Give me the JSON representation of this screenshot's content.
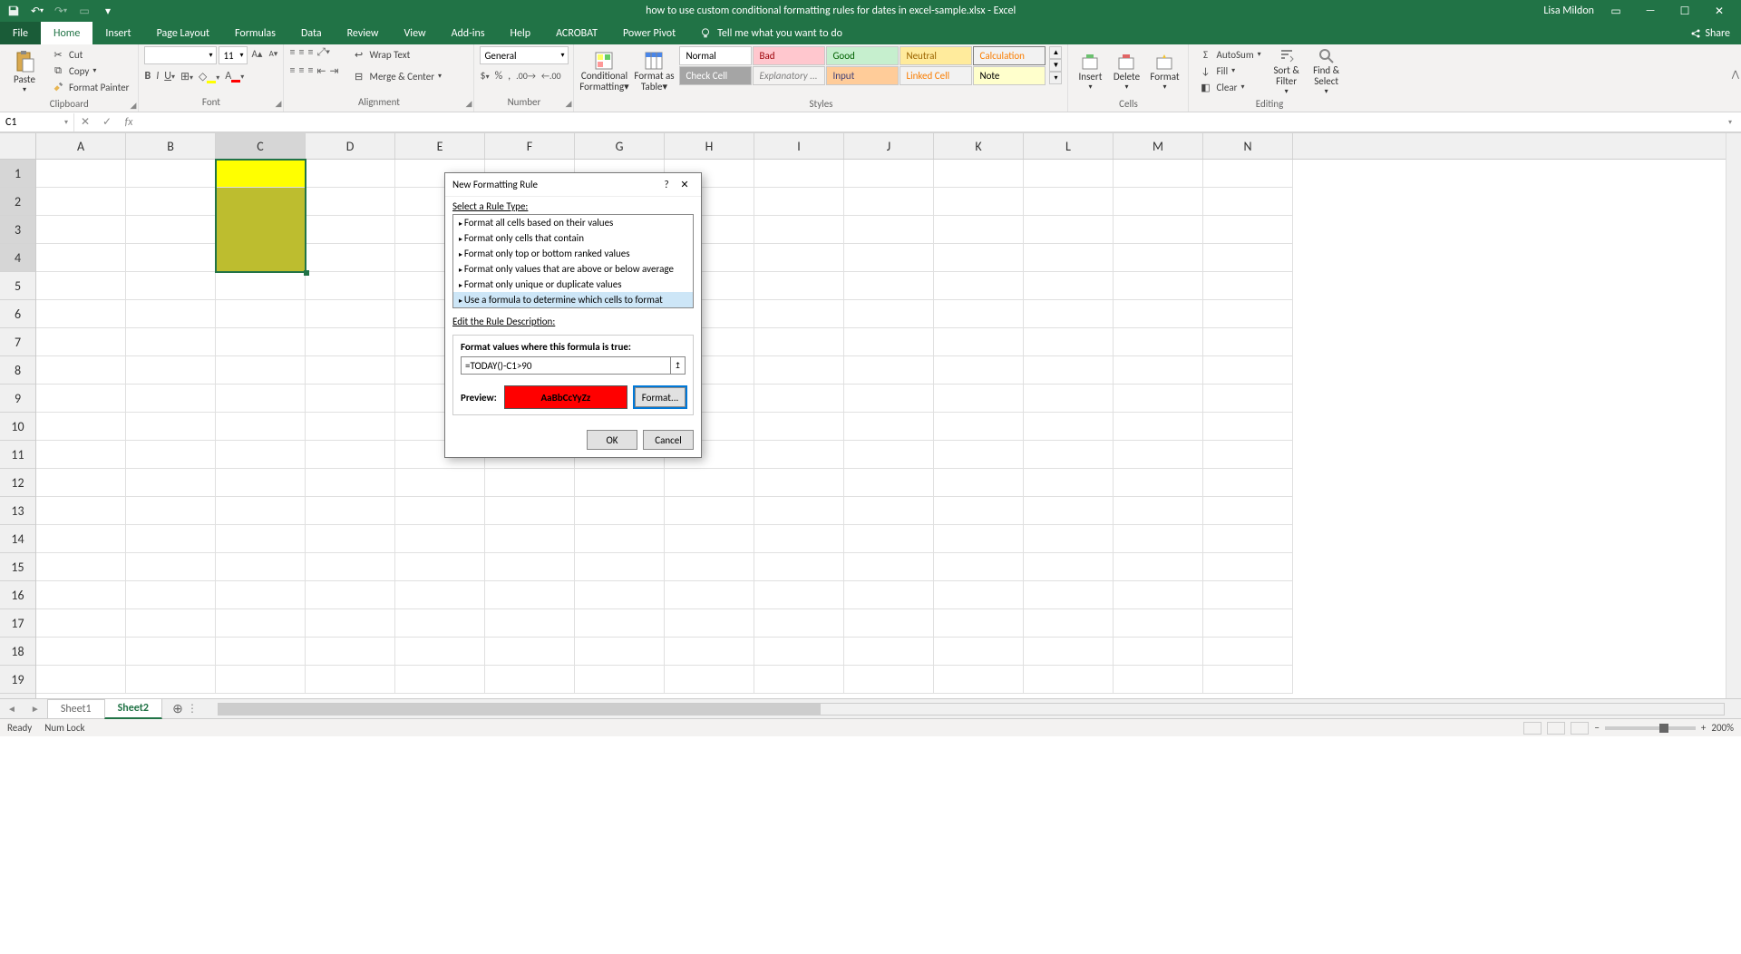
{
  "title": "how to use custom conditional formatting rules for dates in excel-sample.xlsx  -  Excel",
  "user": "Lisa Mildon",
  "share": "Share",
  "tabs": {
    "file": "File",
    "home": "Home",
    "insert": "Insert",
    "pagelayout": "Page Layout",
    "formulas": "Formulas",
    "data": "Data",
    "review": "Review",
    "view": "View",
    "addins": "Add-ins",
    "help": "Help",
    "acrobat": "ACROBAT",
    "powerpivot": "Power Pivot",
    "tellme": "Tell me what you want to do"
  },
  "clipboard": {
    "paste": "Paste",
    "cut": "Cut",
    "copy": "Copy",
    "fp": "Format Painter",
    "label": "Clipboard"
  },
  "font": {
    "name": "",
    "size": "11",
    "label": "Font"
  },
  "alignment": {
    "wrap": "Wrap Text",
    "merge": "Merge & Center",
    "label": "Alignment"
  },
  "number": {
    "fmt": "General",
    "label": "Number"
  },
  "styles": {
    "cf": "Conditional Formatting",
    "fat": "Format as Table",
    "n": "Normal",
    "b": "Bad",
    "g": "Good",
    "neu": "Neutral",
    "calc": "Calculation",
    "chk": "Check Cell",
    "exp": "Explanatory ...",
    "inp": "Input",
    "lnk": "Linked Cell",
    "note": "Note",
    "label": "Styles"
  },
  "cells": {
    "ins": "Insert",
    "del": "Delete",
    "fmt": "Format",
    "label": "Cells"
  },
  "editing": {
    "sum": "AutoSum",
    "fill": "Fill",
    "clr": "Clear",
    "sort": "Sort & Filter",
    "find": "Find & Select",
    "label": "Editing"
  },
  "namebox": "C1",
  "formula": "",
  "cols": [
    "A",
    "B",
    "C",
    "D",
    "E",
    "F",
    "G",
    "H",
    "I",
    "J",
    "K",
    "L",
    "M",
    "N"
  ],
  "rows": [
    "1",
    "2",
    "3",
    "4",
    "5",
    "6",
    "7",
    "8",
    "9",
    "10",
    "11",
    "12",
    "13",
    "14",
    "15",
    "16",
    "17",
    "18",
    "19"
  ],
  "dialog": {
    "title": "New Formatting Rule",
    "selLabel": "Select a Rule Type:",
    "types": [
      "Format all cells based on their values",
      "Format only cells that contain",
      "Format only top or bottom ranked values",
      "Format only values that are above or below average",
      "Format only unique or duplicate values",
      "Use a formula to determine which cells to format"
    ],
    "editLabel": "Edit the Rule Description:",
    "formulaLabel": "Format values where this formula is true:",
    "formula": "=TODAY()-C1>90",
    "previewLabel": "Preview:",
    "previewText": "AaBbCcYyZz",
    "formatBtn": "Format...",
    "ok": "OK",
    "cancel": "Cancel"
  },
  "sheets": {
    "s1": "Sheet1",
    "s2": "Sheet2"
  },
  "status": {
    "ready": "Ready",
    "numlock": "Num Lock",
    "zoom": "200%"
  }
}
